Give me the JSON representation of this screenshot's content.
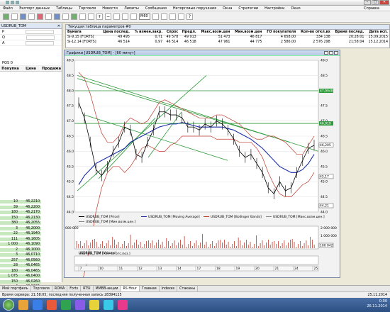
{
  "app": {
    "title": "USDRUB_TOM",
    "menu": [
      "Файл",
      "Экспорт данных",
      "Таблицы",
      "Торговля",
      "Новости",
      "Лимиты",
      "Сообщения",
      "Неторговые поручения",
      "Окна",
      "Стратегии",
      "Настройки",
      "Окно"
    ],
    "menu_right": "Справка",
    "timeframe": "M60"
  },
  "left_panel": {
    "title": "USDRUB_TOM",
    "fields": [
      {
        "label": "Р",
        "value": ""
      },
      {
        "label": "Q",
        "value": ""
      },
      {
        "label": "А",
        "value": ""
      }
    ],
    "pos_label": "POS",
    "pos_value": "0",
    "headers": [
      "Покупка",
      "Цена",
      "Продажа"
    ],
    "book": [
      {
        "vol": "10",
        "price": "46,2210"
      },
      {
        "vol": "39",
        "price": "46,2200"
      },
      {
        "vol": "180",
        "price": "46,2170"
      },
      {
        "vol": "150",
        "price": "46,2130"
      },
      {
        "vol": "380",
        "price": "46,2055"
      },
      {
        "vol": "3",
        "price": "46,2000"
      },
      {
        "vol": "22",
        "price": "46,1940"
      },
      {
        "vol": "111",
        "price": "46,1605"
      },
      {
        "vol": "1 000",
        "price": "46,1090"
      },
      {
        "vol": "2",
        "price": "46,1000"
      },
      {
        "vol": "3",
        "price": "46,0710"
      },
      {
        "vol": "257",
        "price": "46,0560"
      },
      {
        "vol": "28",
        "price": "46,0465"
      },
      {
        "vol": "180",
        "price": "46,0465"
      },
      {
        "vol": "1 075",
        "price": "46,0400"
      },
      {
        "vol": "150",
        "price": "46,0260"
      },
      {
        "vol": "4",
        "price": "46,0225"
      },
      {
        "vol": "1 000",
        "price": "46,0100"
      },
      {
        "vol": "53",
        "price": "46,0000"
      },
      {
        "vol": "27",
        "price": "45,9790"
      }
    ]
  },
  "params": {
    "title": "Текущая таблица параметров #0",
    "headers": [
      "Бумага",
      "Цена послед.",
      "% измен.закр.",
      "Спрос",
      "Предл.",
      "Макс.возм.цен",
      "Мин.возм.цен",
      "ГО покупателя",
      "Кол-во откл.вх",
      "Время послед.",
      "Дата исп."
    ],
    "rows": [
      [
        "Si-9.15 [FORTS]",
        "49 495",
        "0,71",
        "49 578",
        "49 913",
        "51 473",
        "46 817",
        "4 658,00",
        "334 138",
        "20:28:01",
        "15.09.2015"
      ],
      [
        "Si-12.14 [FORTS]",
        "46 514",
        "0,97",
        "46 514",
        "46 518",
        "47 961",
        "44 775",
        "2 586,00",
        "2 576 298",
        "21:58:04",
        "15.12.2014"
      ]
    ]
  },
  "chart": {
    "title": "Графики [USDRUB_TOM] - [60 минут]",
    "price_labels": [
      "49.0",
      "48.5",
      "48.0",
      "47.5",
      "47.0",
      "46.5",
      "46.0",
      "45.5",
      "45.0",
      "44.5",
      "44.0"
    ],
    "badges": {
      "hline1": "47,9948",
      "hline2": "46,919",
      "last": "46,205",
      "lower": "45,17",
      "bottom": "44,21"
    },
    "legend": [
      "USDRUB_TOM [Price]",
      "USDRUB_TOM [Moving Average]",
      "USDRUB_TOM [Bollinger Bands]",
      "USDRUB_TOM [Макс.возм.цен.]",
      "USDRUB_TOM [Мин.возм.цен.]"
    ],
    "vol_labels": [
      "2 000 000",
      "1 000 000"
    ],
    "vol_left": "000 000",
    "vol_badge": "100 042",
    "vol_legend": "USDRUB_TOM [Volume]",
    "sub_legend": "USDRUB_TOM [Кол-во отс.поз.]",
    "dates": [
      "7",
      "10",
      "11",
      "12",
      "13",
      "14",
      "17",
      "18",
      "19",
      "20",
      "21",
      "24",
      "25"
    ]
  },
  "chart_data": {
    "type": "line",
    "title": "Графики [USDRUB_TOM] - [60 минут]",
    "ylim": [
      44.0,
      49.0
    ],
    "series": [
      {
        "name": "USDRUB_TOM [Price]",
        "values": [
          47.6,
          47.1,
          46.3,
          45.4,
          45.2,
          45.5,
          46.0,
          46.3,
          46.8,
          46.7,
          45.9,
          45.8,
          46.3,
          46.7,
          47.3,
          47.3,
          47.2,
          47.2,
          47.1,
          46.8,
          46.8,
          46.7,
          46.9,
          46.8,
          47.0,
          46.9,
          46.7,
          46.4,
          46.0,
          45.8,
          45.9,
          45.6,
          45.3,
          44.8,
          44.6,
          45.0,
          44.7,
          44.8,
          45.3,
          45.7,
          46.1,
          46.2
        ]
      },
      {
        "name": "USDRUB_TOM [Moving Average]",
        "values": [
          44.9,
          45.2,
          45.4,
          45.6,
          45.7,
          45.8,
          45.9,
          46.0,
          46.1,
          46.3,
          46.4,
          46.5,
          46.6,
          46.7,
          46.8,
          46.85,
          46.9,
          46.9,
          46.95,
          46.9,
          46.85,
          46.8,
          46.8,
          46.8,
          46.8,
          46.8,
          46.75,
          46.7,
          46.6,
          46.5,
          46.4,
          46.25,
          46.1,
          45.9,
          45.7,
          45.5,
          45.4,
          45.3,
          45.3,
          45.4,
          45.6,
          45.9
        ]
      },
      {
        "name": "USDRUB_TOM [Bollinger Bands]",
        "values": [
          48.6,
          48.4,
          47.9,
          47.2,
          46.6,
          46.3,
          46.3,
          46.5,
          46.9,
          47.1,
          47.0,
          46.9,
          47.0,
          47.3,
          47.6,
          47.7,
          47.6,
          47.5,
          47.4,
          47.3,
          47.2,
          47.1,
          47.1,
          47.1,
          47.2,
          47.2,
          47.1,
          47.0,
          46.9,
          46.7,
          46.5,
          46.4,
          46.4,
          46.5,
          46.5,
          46.4,
          46.3,
          46.1,
          45.9,
          45.9,
          46.2,
          46.5
        ]
      }
    ]
  },
  "bottom_tabs": [
    "Мой портфель",
    "Торговля",
    "ROMA",
    "Forts",
    "RTSI",
    "MMBB-акции",
    "RS Hour",
    "Главная",
    "Indexes",
    "Стаканы"
  ],
  "active_tab": "RS Hour",
  "status": {
    "text": "Время сервера: 21:58:05; последняя полученная запись 28394125",
    "date": "25.11.2014"
  },
  "taskbar": {
    "time": "0:00",
    "date": "26.11.2014",
    "apps": [
      "#e8a33a",
      "#3a7ee8",
      "#e85a3a",
      "#2fa34f",
      "#8a5ae8",
      "#e8d23a",
      "#3ac8e8",
      "#e83a8a"
    ]
  },
  "colors": {
    "price": "#000000",
    "ma": "#1c2fa8",
    "bands": "#c0392b",
    "trend": "#2e9a3a",
    "ask_bg": "#c8e9c0"
  }
}
